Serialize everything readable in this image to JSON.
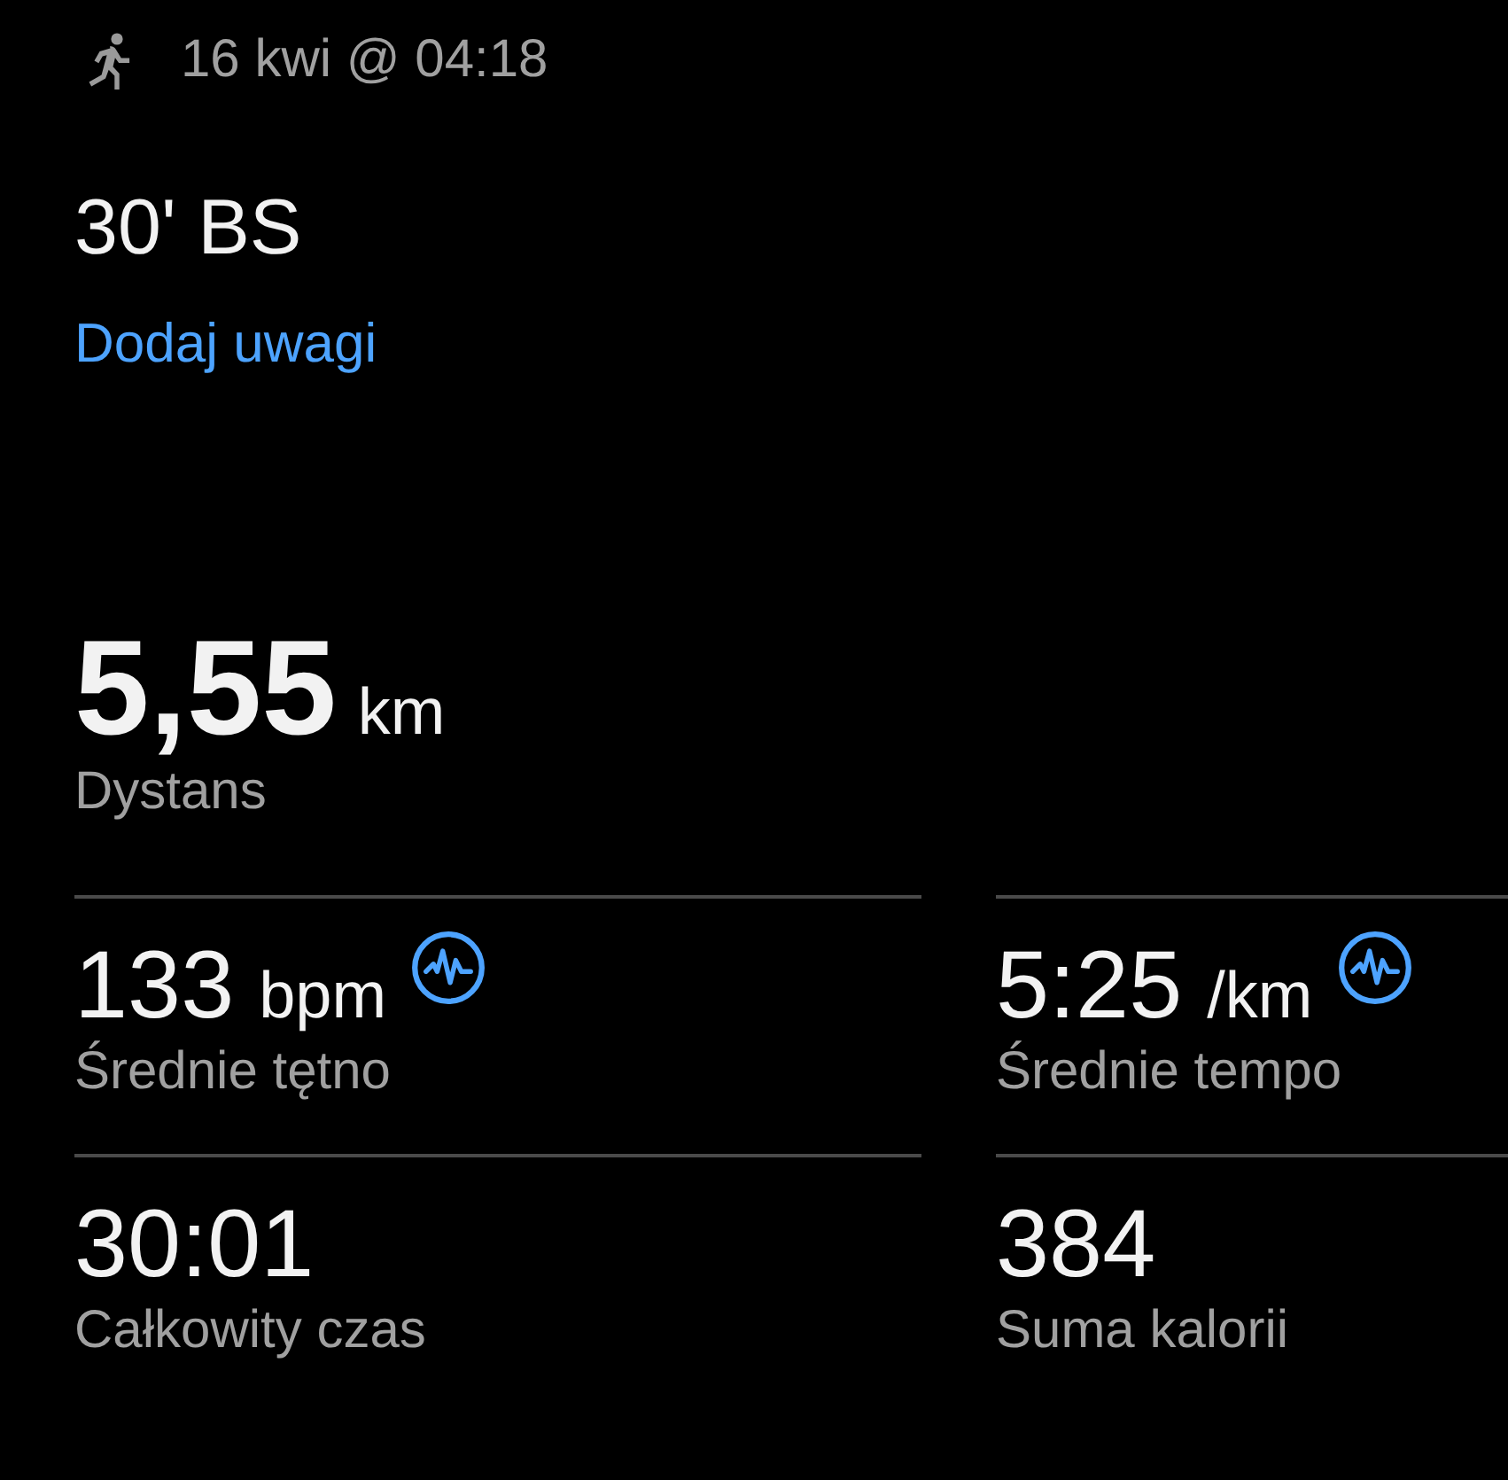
{
  "header": {
    "date": "16 kwi @ 04:18"
  },
  "title": "30' BS",
  "notes_link": "Dodaj uwagi",
  "distance": {
    "value": "5,55",
    "unit": "km",
    "label": "Dystans"
  },
  "stats": [
    {
      "value": "133",
      "unit": "bpm",
      "label": "Średnie tętno",
      "graph": true
    },
    {
      "value": "5:25",
      "unit": "/km",
      "label": "Średnie tempo",
      "graph": true
    },
    {
      "value": "30:01",
      "label": "Całkowity czas",
      "graph": false
    },
    {
      "value": "384",
      "label": "Suma kalorii",
      "graph": false
    }
  ]
}
